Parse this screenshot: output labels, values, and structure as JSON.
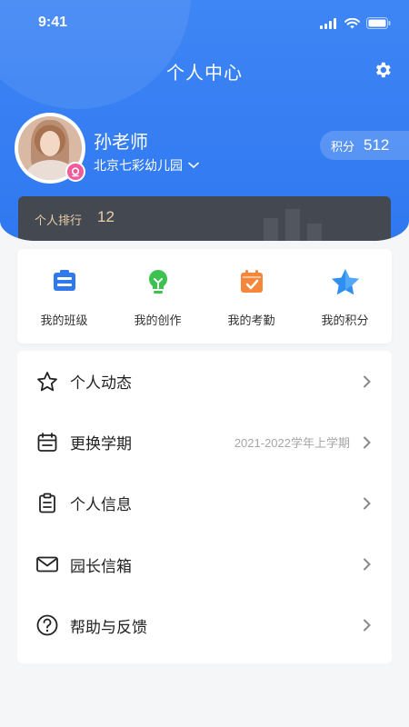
{
  "status_bar": {
    "time": "9:41"
  },
  "header": {
    "title": "个人中心",
    "settings_icon": "gear-icon"
  },
  "profile": {
    "name": "孙老师",
    "school": "北京七彩幼儿园",
    "points_label": "积分",
    "points_value": "512"
  },
  "rank": {
    "label": "个人排行",
    "value": "12"
  },
  "quick_actions": [
    {
      "label": "我的班级",
      "icon": "class-icon",
      "color": "#2f78f0"
    },
    {
      "label": "我的创作",
      "icon": "bulb-icon",
      "color": "#3dc24f"
    },
    {
      "label": "我的考勤",
      "icon": "calendar-check-icon",
      "color": "#f5873c"
    },
    {
      "label": "我的积分",
      "icon": "star-icon",
      "color": "#2f8ff0"
    }
  ],
  "menu": [
    {
      "label": "个人动态",
      "icon": "star-outline-icon",
      "extra": ""
    },
    {
      "label": "更换学期",
      "icon": "calendar-icon",
      "extra": "2021-2022学年上学期"
    },
    {
      "label": "个人信息",
      "icon": "clipboard-icon",
      "extra": ""
    },
    {
      "label": "园长信箱",
      "icon": "mail-icon",
      "extra": ""
    },
    {
      "label": "帮助与反馈",
      "icon": "help-icon",
      "extra": ""
    }
  ],
  "colors": {
    "primary": "#2f78f0",
    "rank_bg": "#444851",
    "rank_text": "#e9cfa6"
  }
}
